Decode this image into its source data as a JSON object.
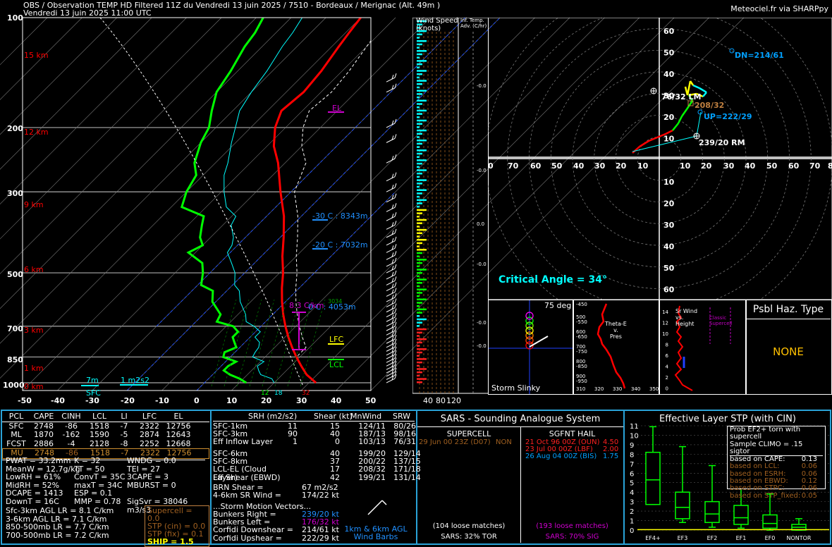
{
  "header": {
    "title": "OBS / Observation TEMP HD Filtered 11Z du Vendredi 13 juin 2025 / 7510 - Bordeaux / Merignac (Alt. 49m )",
    "valid": "Vendredi 13 juin 2025 11:00 UTC",
    "credit": "Meteociel.fr via SHARPpy"
  },
  "skewt": {
    "pressure_ticks": [
      "100",
      "200",
      "300",
      "500",
      "700",
      "850",
      "1000"
    ],
    "temp_ticks": [
      "-50",
      "-40",
      "-30",
      "-20",
      "-10",
      "0",
      "10",
      "20",
      "30",
      "40",
      "50"
    ],
    "height_ticks": [
      "15 km",
      "12 km",
      "9 km",
      "6 km",
      "3 km",
      "1 km",
      "0 km"
    ],
    "labels": {
      "el": "EL",
      "lfc": "LFC",
      "lcl": "LCL",
      "m30": "-30 C : 8343m",
      "m20": "-20 C : 7032m",
      "zero": "0 C : 4053m",
      "lapse": "8.3 C/km",
      "sfc": "SFC",
      "m7": "7m",
      "m2s2": "1 m2s2",
      "sfc_t": "32",
      "sfc_td": "12",
      "sfc_rh": "18",
      "lapse_hint": "3034"
    },
    "colors": {
      "temp": "#ff0000",
      "dew": "#00ff00",
      "wetbulb": "#00ffff",
      "parcel": "#ffffff"
    },
    "chart_data": {
      "type": "line",
      "title": "",
      "xlabel": "",
      "ylabel": "",
      "xlim": [
        -50,
        50
      ],
      "ylim_hpa": [
        1050,
        100
      ],
      "log_scale_y": true,
      "series": [
        {
          "values": [
            [
              1000,
              32
            ],
            [
              950,
              27
            ],
            [
              900,
              23
            ],
            [
              850,
              19
            ],
            [
              800,
              15
            ],
            [
              750,
              11
            ],
            [
              700,
              7
            ],
            [
              650,
              3
            ],
            [
              600,
              -1
            ],
            [
              550,
              -5
            ],
            [
              500,
              -9
            ],
            [
              450,
              -14
            ],
            [
              400,
              -19
            ],
            [
              350,
              -25
            ],
            [
              300,
              -33
            ],
            [
              250,
              -42
            ],
            [
              225,
              -48
            ],
            [
              200,
              -53
            ],
            [
              180,
              -56
            ],
            [
              160,
              -55
            ],
            [
              140,
              -56
            ],
            [
              120,
              -58
            ],
            [
              110,
              -59
            ],
            [
              100,
              -60
            ]
          ]
        },
        {
          "values": [
            [
              1000,
              12
            ],
            [
              975,
              9
            ],
            [
              950,
              5
            ],
            [
              925,
              2
            ],
            [
              900,
              2
            ],
            [
              875,
              3
            ],
            [
              850,
              -2
            ],
            [
              825,
              -3
            ],
            [
              800,
              -1
            ],
            [
              775,
              -3
            ],
            [
              750,
              -5
            ],
            [
              725,
              -5
            ],
            [
              700,
              -8
            ],
            [
              680,
              -14
            ],
            [
              650,
              -15
            ],
            [
              600,
              -21
            ],
            [
              560,
              -24
            ],
            [
              540,
              -29
            ],
            [
              500,
              -32
            ],
            [
              470,
              -35
            ],
            [
              440,
              -42
            ],
            [
              420,
              -40
            ],
            [
              400,
              -43
            ],
            [
              370,
              -46
            ],
            [
              350,
              -48
            ],
            [
              330,
              -57
            ],
            [
              300,
              -60
            ],
            [
              270,
              -62
            ],
            [
              250,
              -66
            ],
            [
              220,
              -70
            ],
            [
              200,
              -72
            ],
            [
              180,
              -76
            ],
            [
              160,
              -80
            ],
            [
              140,
              -82
            ],
            [
              120,
              -85
            ],
            [
              110,
              -86
            ],
            [
              100,
              -88
            ]
          ]
        }
      ]
    }
  },
  "wind_panel": {
    "title": "Wind Speed (knots)",
    "ticks": [
      "40",
      "80",
      "120"
    ],
    "inf_title": "Inf. Temp. Adv. (C/hr)",
    "inf_ticks": [
      "-0.0",
      "-0.0",
      "0.0",
      "-0.0",
      "-0.0",
      "-0.0"
    ],
    "inf_ticks_extra": [
      "0.0",
      "-0.0",
      "-0.0",
      "0.0",
      "-0.0"
    ]
  },
  "hodograph": {
    "ring_labels_top": [
      "60",
      "50",
      "40",
      "30",
      "20",
      "10"
    ],
    "ring_labels_bottom": [
      "10",
      "20",
      "30",
      "40",
      "50",
      "60"
    ],
    "x_labels": [
      "0",
      "70",
      "60",
      "50",
      "40",
      "30",
      "20",
      "10",
      "10",
      "20",
      "30",
      "40",
      "50",
      "60",
      "70",
      "8"
    ],
    "markers": {
      "dn": "DN=214/61",
      "lm": "76/32 LM",
      "mean": "208/32",
      "up": "UP=222/29",
      "rm": "239/20 RM"
    },
    "critical_angle": "Critical Angle = 34°"
  },
  "small_panels": {
    "slinky_deg": "75 deg",
    "slinky_title": "Storm Slinky",
    "thetae_title1": "Theta-E",
    "thetae_title2": "v.",
    "thetae_title3": "Pres",
    "thetae_p": [
      "500",
      "600",
      "700",
      "800",
      "900"
    ],
    "thetae_p_top": "-450",
    "thetae_p_mid": [
      "-550",
      "-650",
      "-750",
      "-850",
      "-950"
    ],
    "thetae_x": [
      "310",
      "320",
      "330",
      "340",
      "350"
    ],
    "srw_title1": "Sr Wind",
    "srw_title2": "vs.",
    "srw_title3": "Height",
    "srw_classic1": "Classic",
    "srw_classic2": "Supercell",
    "srw_y": [
      "14",
      "12",
      "10",
      "8",
      "6",
      "4",
      "2",
      "0"
    ],
    "hazard_title": "Psbl Haz. Type",
    "hazard_value": "NONE"
  },
  "params_left": {
    "columns": [
      "PCL",
      "CAPE",
      "CINH",
      "LCL",
      "LI",
      "LFC",
      "EL"
    ],
    "rows": [
      [
        "SFC",
        "2748",
        "-86",
        "1518",
        "-7",
        "2322",
        "12756"
      ],
      [
        "ML",
        "1870",
        "-162",
        "1590",
        "-5",
        "2874",
        "12643"
      ],
      [
        "FCST",
        "2886",
        "-4",
        "2128",
        "-8",
        "2252",
        "12668"
      ],
      [
        "MU",
        "2748",
        "-86",
        "1518",
        "-7",
        "2322",
        "12756"
      ]
    ],
    "stats": [
      [
        "PWAT = 33.2mm",
        "K = 32",
        "WNDG = 0.0"
      ],
      [
        "MeanW = 12.7g/kg",
        "TT = 50",
        "TEI = 27"
      ],
      [
        "LowRH = 61%",
        "ConvT = 35C",
        "3CAPE = 3"
      ],
      [
        "MidRH = 52%",
        "maxT = 34C",
        "MBURST = 0"
      ],
      [
        "DCAPE = 1413",
        "ESP = 0.1",
        ""
      ],
      [
        "DownT = 16C",
        "MMP = 0.78",
        "SigSvr = 38046 m3/s3"
      ]
    ],
    "lapse": [
      "Sfc-3km AGL LR = 8.1 C/km",
      "3-6km AGL LR = 7.1 C/km",
      "850-500mb LR = 7.7 C/km",
      "700-500mb LR = 7.2 C/km"
    ],
    "composites": [
      "Supercell = 0.0",
      "STP (cin) = 0.0",
      "STP (fix) = 0.1",
      "SHIP = 1.5"
    ]
  },
  "params_kin": {
    "columns": [
      "SRH (m2/s2)",
      "Shear (kt)",
      "MnWind",
      "SRW"
    ],
    "rows1": [
      [
        "SFC-1km",
        "11",
        "15",
        "124/11",
        "80/26"
      ],
      [
        "SFC-3km",
        "90",
        "40",
        "187/13",
        "98/16"
      ],
      [
        "Eff Inflow Layer",
        "1",
        "0",
        "103/13",
        "76/31"
      ]
    ],
    "rows2": [
      [
        "SFC-6km",
        "",
        "40",
        "199/20",
        "129/14"
      ],
      [
        "SFC-8km",
        "",
        "37",
        "200/22",
        "137/15"
      ],
      [
        "LCL-EL (Cloud Layer)",
        "",
        "17",
        "208/32",
        "171/18"
      ],
      [
        "Eff Shear (EBWD)",
        "",
        "42",
        "199/21",
        "131/14"
      ]
    ],
    "brn": [
      "BRN Shear =",
      "67 m2/s2"
    ],
    "sr46": [
      "4-6km SR Wind =",
      "174/22 kt"
    ],
    "vectors_title": "...Storm Motion Vectors...",
    "vectors": [
      [
        "Bunkers Right =",
        "239/20 kt"
      ],
      [
        "Bunkers Left =",
        "176/32 kt"
      ],
      [
        "Corfidi Downshear =",
        "214/61 kt"
      ],
      [
        "Corfidi Upshear =",
        "222/29 kt"
      ]
    ],
    "barbs_note1": "1km & 6km AGL",
    "barbs_note2": "Wind Barbs"
  },
  "sars": {
    "title": "SARS - Sounding Analogue System",
    "supercell": "SUPERCELL",
    "hail": "SGFNT HAIL",
    "sc_match": [
      "29 Jun 00 23Z (D07)",
      "NON"
    ],
    "hail_matches": [
      [
        "21 Oct 96 00Z (OUN)",
        "4.50"
      ],
      [
        "23 Jul 00 00Z (LBF)",
        "2.00"
      ],
      [
        "26 Aug 04 00Z (BIS)",
        "1.75"
      ]
    ],
    "sc_loose": "(104 loose matches)",
    "sc_tor": "SARS: 32% TOR",
    "hail_loose": "(193 loose matches)",
    "hail_sig": "SARS: 70% SIG"
  },
  "stp": {
    "title": "Effective Layer STP (with CIN)",
    "y_ticks": [
      "11",
      "10",
      "9",
      "8",
      "7",
      "6",
      "5",
      "4",
      "3",
      "2",
      "1",
      "0"
    ],
    "categories": [
      "EF4+",
      "EF3",
      "EF2",
      "EF1",
      "EF0",
      "NONTOR"
    ],
    "prob_lines": [
      "Prob EF2+ torn with supercell",
      "Sample CLIMO = .15 sigtor"
    ],
    "based": [
      [
        "based on CAPE:",
        "0.13"
      ],
      [
        "based on LCL:",
        "0.06"
      ],
      [
        "based on ESRH:",
        "0.06"
      ],
      [
        "based on EBWD:",
        "0.12"
      ],
      [
        "based on STPC:",
        "0.06"
      ],
      [
        "based on STP_fixed:",
        "0.05"
      ]
    ],
    "chart_data": {
      "type": "bar",
      "categories": [
        "EF4+",
        "EF3",
        "EF2",
        "EF1",
        "EF0",
        "NONTOR"
      ],
      "boxes": [
        {
          "lo": 2.7,
          "q1": 2.7,
          "med": 5.3,
          "q3": 8.2,
          "hi": 10.9
        },
        {
          "lo": 0.8,
          "q1": 1.2,
          "med": 2.4,
          "q3": 4.0,
          "hi": 8.8
        },
        {
          "lo": 0.3,
          "q1": 0.8,
          "med": 1.7,
          "q3": 3.0,
          "hi": 6.8
        },
        {
          "lo": 0.2,
          "q1": 0.6,
          "med": 1.3,
          "q3": 2.6,
          "hi": 5.0
        },
        {
          "lo": 0.0,
          "q1": 0.2,
          "med": 0.7,
          "q3": 1.6,
          "hi": 3.8
        },
        {
          "lo": 0.0,
          "q1": 0.0,
          "med": 0.3,
          "q3": 0.6,
          "hi": 1.2
        }
      ],
      "ylim": [
        0,
        11
      ]
    }
  }
}
